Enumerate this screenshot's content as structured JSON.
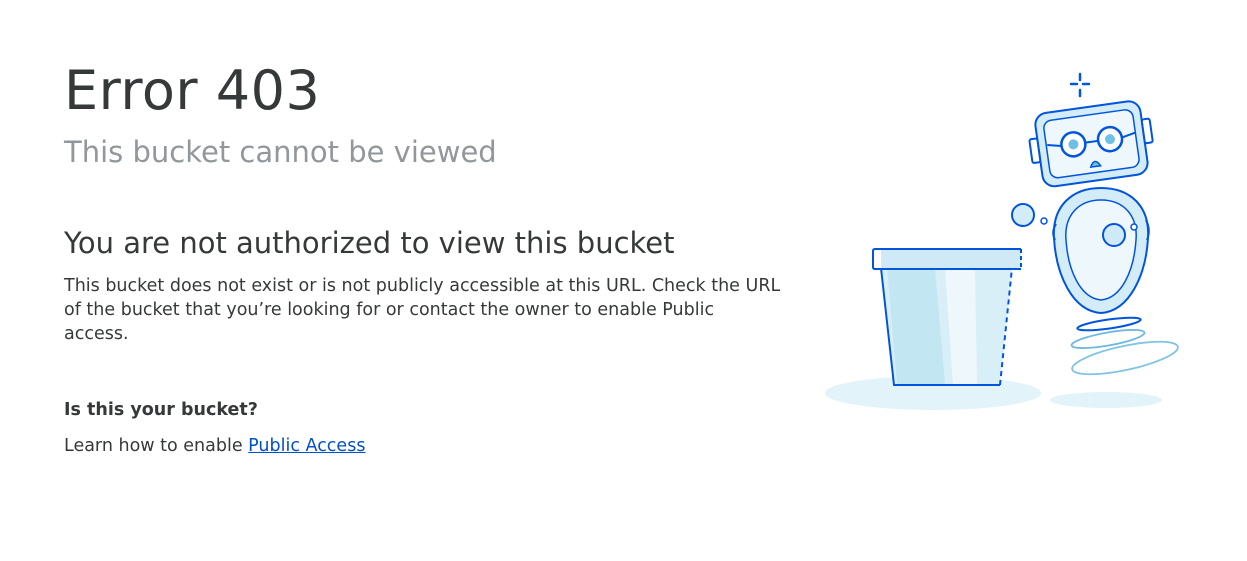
{
  "error": {
    "title": "Error 403",
    "subtitle": "This bucket cannot be viewed"
  },
  "main": {
    "heading": "You are not authorized to view this bucket",
    "description": "This bucket does not exist or is not publicly accessible at this URL. Check the URL of the bucket that you’re looking for or contact the owner to enable Public access.",
    "question": "Is this your bucket?",
    "learn_prefix": "Learn how to enable ",
    "learn_link": "Public Access"
  },
  "colors": {
    "link": "#0051c3",
    "heading": "#36393a",
    "subtitle": "#92979b",
    "illustration_stroke": "#0055dc",
    "illustration_fill": "#cdeaf6"
  },
  "icons": {
    "illustration": "robot-bucket-illustration"
  }
}
